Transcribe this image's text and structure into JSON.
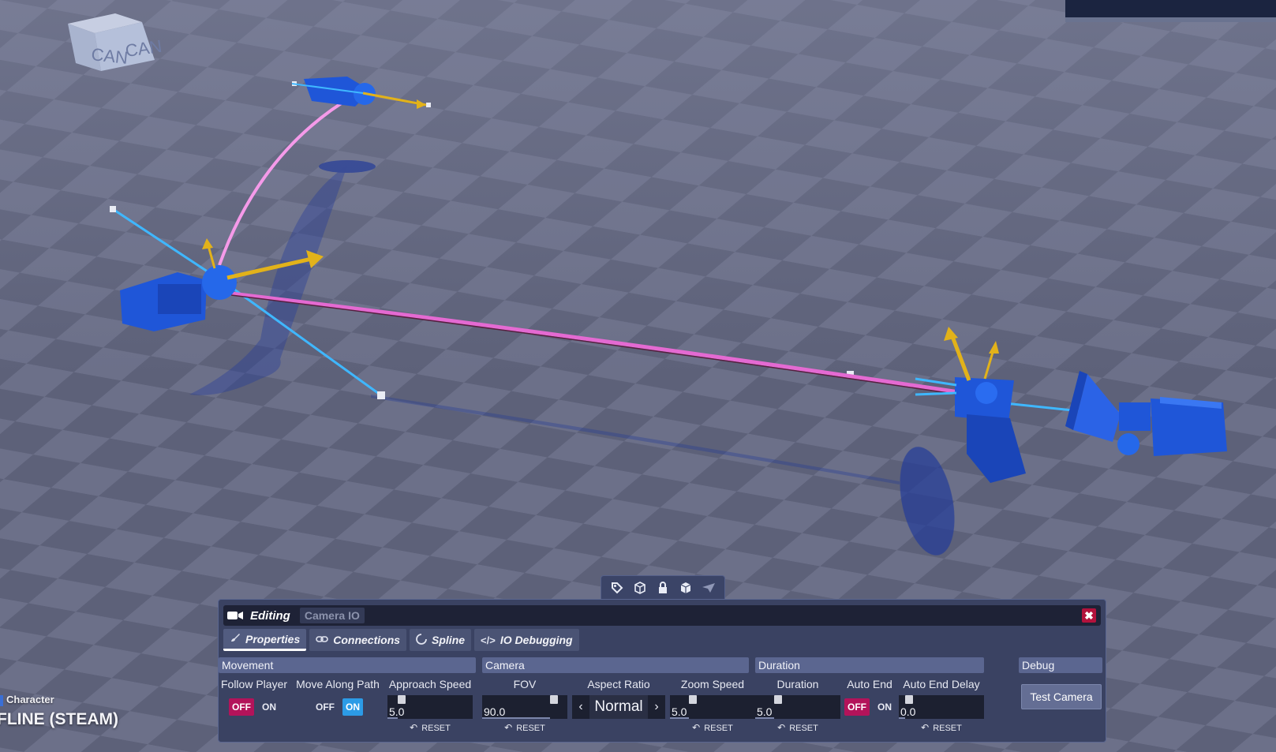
{
  "scene": {
    "cube_label": "CAM",
    "hud": {
      "mode_label": "Character",
      "status": "FLINE (STEAM)"
    },
    "colors": {
      "camera_blue": "#1f56d8",
      "path_pink": "#e66ad6",
      "axis_yellow": "#e2b21a",
      "axis_cyan": "#3fb7ff"
    }
  },
  "gizmo_toolbar": {
    "buttons": [
      {
        "icon": "tag-icon"
      },
      {
        "icon": "cube-outline-icon"
      },
      {
        "icon": "lock-icon"
      },
      {
        "icon": "cube-icon"
      },
      {
        "icon": "plane-icon"
      }
    ]
  },
  "panel": {
    "title": "Editing",
    "subtitle_tab": "Camera IO",
    "close_label": "✖",
    "tabs": [
      {
        "label": "Properties",
        "icon": "brush-icon",
        "active": true
      },
      {
        "label": "Connections",
        "icon": "link-icon",
        "active": false
      },
      {
        "label": "Spline",
        "icon": "spline-icon",
        "active": false
      },
      {
        "label": "IO Debugging",
        "icon": "code-icon",
        "active": false
      }
    ],
    "sections": {
      "movement": {
        "header": "Movement",
        "follow_player": {
          "label": "Follow Player",
          "off": "OFF",
          "on": "ON",
          "value": "OFF"
        },
        "move_along_path": {
          "label": "Move Along Path",
          "off": "OFF",
          "on": "ON",
          "value": "ON"
        },
        "approach_speed": {
          "label": "Approach Speed",
          "value": "5.0",
          "fraction": 0.05,
          "reset": "RESET"
        }
      },
      "camera": {
        "header": "Camera",
        "fov": {
          "label": "FOV",
          "value": "90.0",
          "fraction": 0.72,
          "reset": "RESET"
        },
        "aspect_ratio": {
          "label": "Aspect Ratio",
          "value": "Normal",
          "prev": "‹",
          "next": "›"
        },
        "zoom_speed": {
          "label": "Zoom Speed",
          "value": "5.0",
          "fraction": 0.15,
          "reset": "RESET"
        }
      },
      "duration": {
        "header": "Duration",
        "duration": {
          "label": "Duration",
          "value": "5.0",
          "fraction": 0.15,
          "reset": "RESET"
        },
        "auto_end": {
          "label": "Auto End",
          "off": "OFF",
          "on": "ON",
          "value": "OFF"
        },
        "auto_end_delay": {
          "label": "Auto End Delay",
          "value": "0.0",
          "fraction": 0.0,
          "reset": "RESET"
        }
      },
      "debug": {
        "header": "Debug",
        "test_camera": "Test Camera"
      }
    }
  }
}
